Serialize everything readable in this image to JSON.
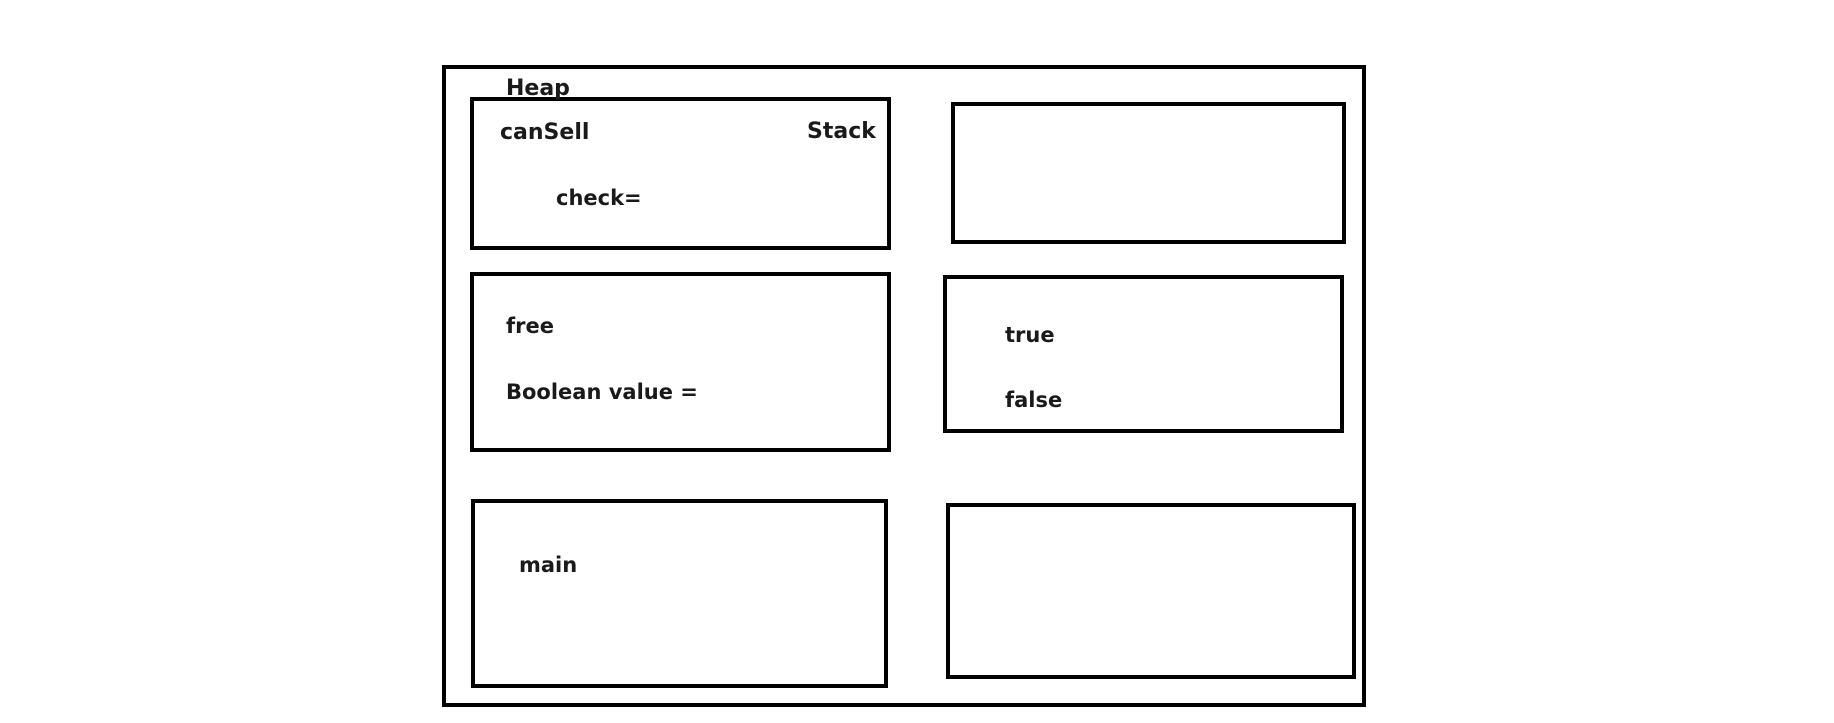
{
  "heap_label": "Heap",
  "stack_label": "Stack",
  "frames": {
    "can_sell": {
      "name": "canSell",
      "variable": "check="
    },
    "free": {
      "name": "free",
      "variable": "Boolean value ="
    },
    "main": {
      "name": "main"
    }
  },
  "heap_values": {
    "true_label": "true",
    "false_label": "false"
  }
}
